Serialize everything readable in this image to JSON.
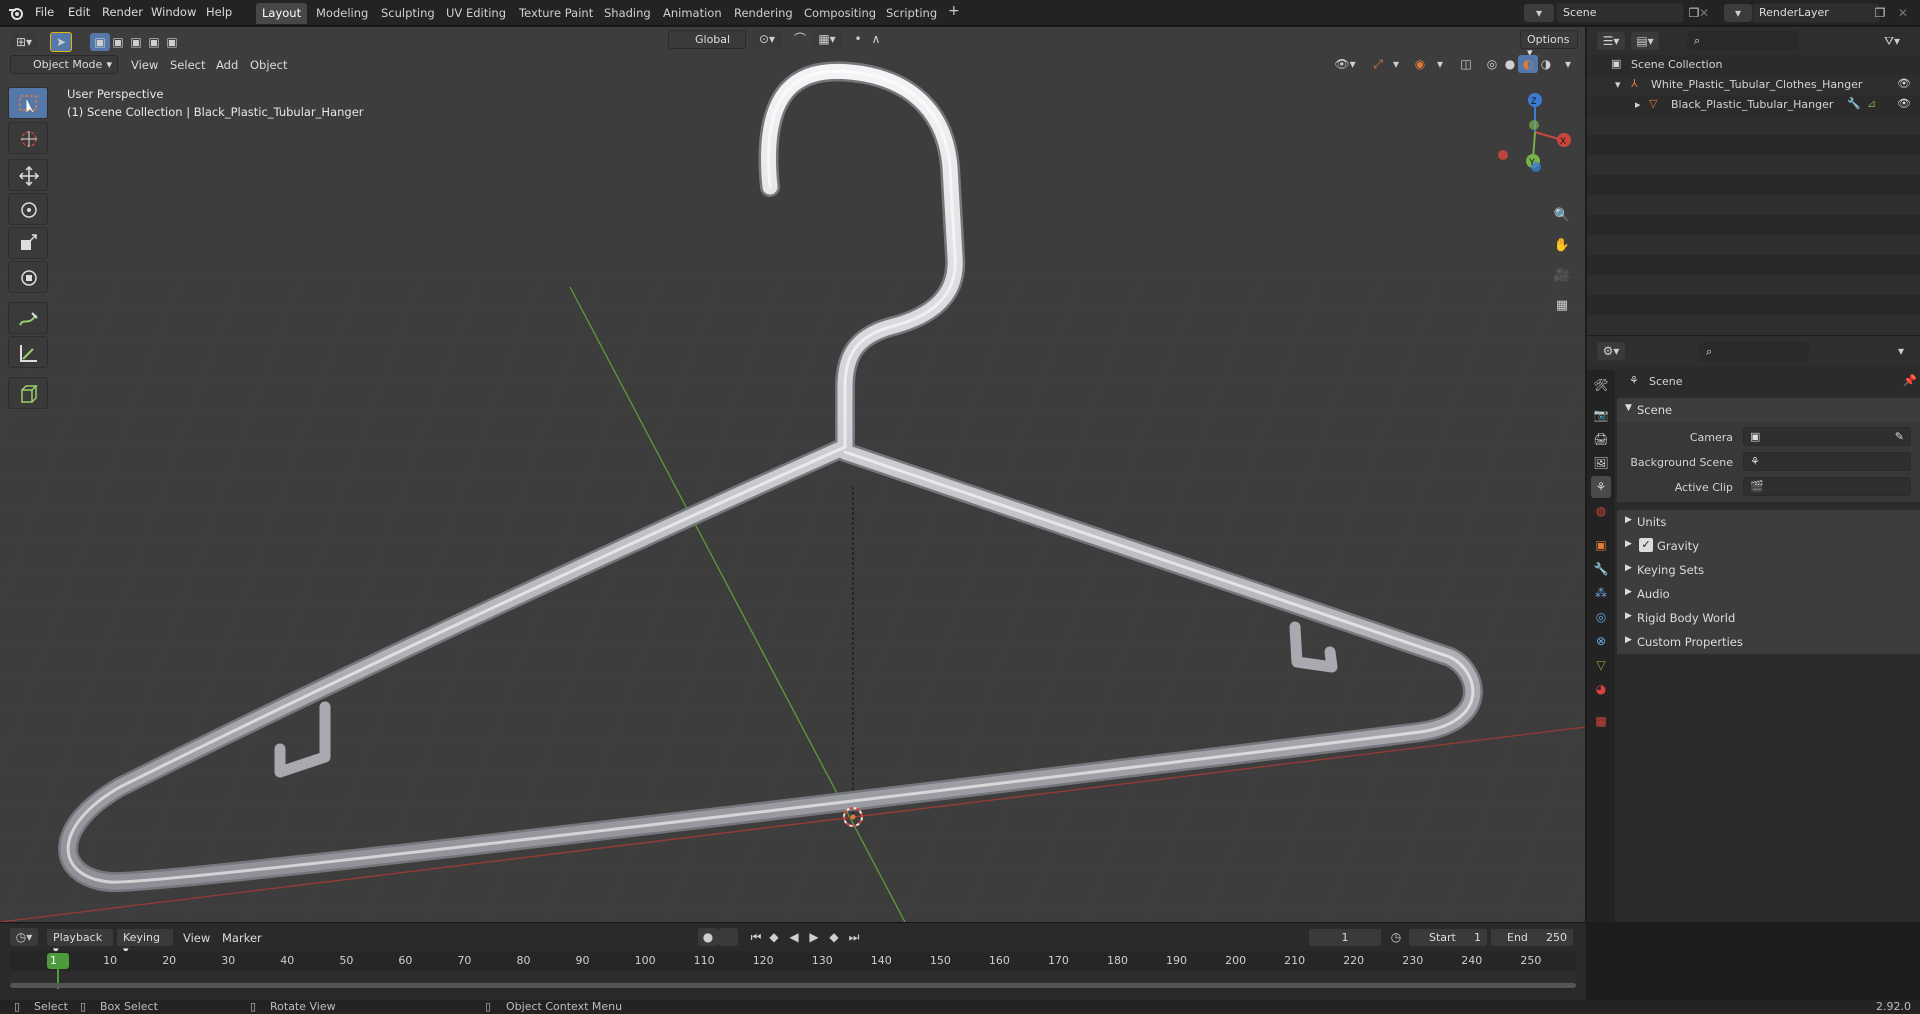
{
  "topbar": {
    "menus": [
      "File",
      "Edit",
      "Render",
      "Window",
      "Help"
    ],
    "workspaces": [
      "Layout",
      "Modeling",
      "Sculpting",
      "UV Editing",
      "Texture Paint",
      "Shading",
      "Animation",
      "Rendering",
      "Compositing",
      "Scripting"
    ],
    "active_workspace": "Layout",
    "scene_name": "Scene",
    "render_layer": "RenderLayer"
  },
  "viewport": {
    "mode": "Object Mode",
    "header_menus": [
      "View",
      "Select",
      "Add",
      "Object"
    ],
    "orientation": "Global",
    "options_label": "Options",
    "overlay_title": "User Perspective",
    "overlay_subtitle": "(1) Scene Collection | Black_Plastic_Tubular_Hanger",
    "gizmo": {
      "x": "X",
      "y": "Y",
      "z": "Z"
    }
  },
  "outliner": {
    "root": "Scene Collection",
    "items": [
      {
        "label": "White_Plastic_Tubular_Clothes_Hanger",
        "icon": "armature-icon"
      },
      {
        "label": "Black_Plastic_Tubular_Hanger",
        "icon": "mesh-icon"
      }
    ]
  },
  "properties": {
    "context_title": "Scene",
    "section_title": "Scene",
    "fields": [
      {
        "label": "Camera",
        "value": ""
      },
      {
        "label": "Background Scene",
        "value": ""
      },
      {
        "label": "Active Clip",
        "value": ""
      }
    ],
    "subpanels": [
      "Units",
      "Gravity",
      "Keying Sets",
      "Audio",
      "Rigid Body World",
      "Custom Properties"
    ],
    "gravity_checked": true
  },
  "timeline": {
    "menus": [
      "Playback",
      "Keying",
      "View",
      "Marker"
    ],
    "current_frame": "1",
    "start_label": "Start",
    "start_value": "1",
    "end_label": "End",
    "end_value": "250",
    "ticks": [
      "1",
      "10",
      "20",
      "30",
      "40",
      "50",
      "60",
      "70",
      "80",
      "90",
      "100",
      "110",
      "120",
      "130",
      "140",
      "150",
      "160",
      "170",
      "180",
      "190",
      "200",
      "210",
      "220",
      "230",
      "240",
      "250"
    ]
  },
  "statusbar": {
    "select": "Select",
    "box_select": "Box Select",
    "rotate": "Rotate View",
    "context_menu": "Object Context Menu",
    "version": "2.92.0"
  },
  "colors": {
    "accent": "#e07a3a",
    "active_blue": "#5378a9",
    "axis_x": "#c9473e",
    "axis_y": "#78b04a",
    "axis_z": "#3d7bd4"
  }
}
